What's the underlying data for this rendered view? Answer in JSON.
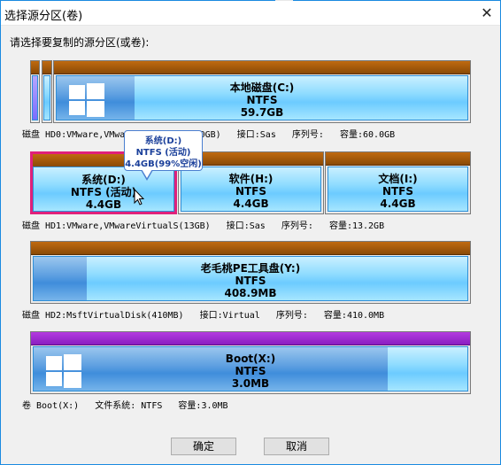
{
  "window": {
    "title": "选择源分区(卷)",
    "close_icon": "✕"
  },
  "prompt": "请选择要复制的源分区(或卷):",
  "disk0": {
    "partition_c": {
      "name": "本地磁盘(C:)",
      "fs": "NTFS",
      "size": "59.7GB"
    },
    "info": "磁盘 HD0:VMware,VMware Virtual S(60GB)   接口:Sas   序列号:   容量:60.0GB"
  },
  "disk1": {
    "partition_d": {
      "name": "系统(D:)",
      "fs": "NTFS (活动)",
      "size": "4.4GB"
    },
    "partition_h": {
      "name": "软件(H:)",
      "fs": "NTFS",
      "size": "4.4GB"
    },
    "partition_i": {
      "name": "文档(I:)",
      "fs": "NTFS",
      "size": "4.4GB"
    },
    "info": "磁盘 HD1:VMware,VMwareVirtualS(13GB)   接口:Sas   序列号:   容量:13.2GB"
  },
  "disk2": {
    "partition_y": {
      "name": "老毛桃PE工具盘(Y:)",
      "fs": "NTFS",
      "size": "408.9MB"
    },
    "info": "磁盘 HD2:MsftVirtualDisk(410MB)   接口:Virtual   序列号:   容量:410.0MB"
  },
  "disk3": {
    "partition_x": {
      "name": "Boot(X:)",
      "fs": "NTFS",
      "size": "3.0MB"
    },
    "info": "卷 Boot(X:)   文件系统: NTFS   容量:3.0MB"
  },
  "tooltip": {
    "line1": "系统(D:)",
    "line2": "NTFS (活动)",
    "line3": "4.4GB(99%空闲)"
  },
  "buttons": {
    "ok": "确定",
    "cancel": "取消"
  },
  "colors": {
    "accent": "#1a8ae0",
    "selected": "#e0207a",
    "cap_brown": "#a05a0a",
    "cap_purple": "#9b2ad0"
  }
}
